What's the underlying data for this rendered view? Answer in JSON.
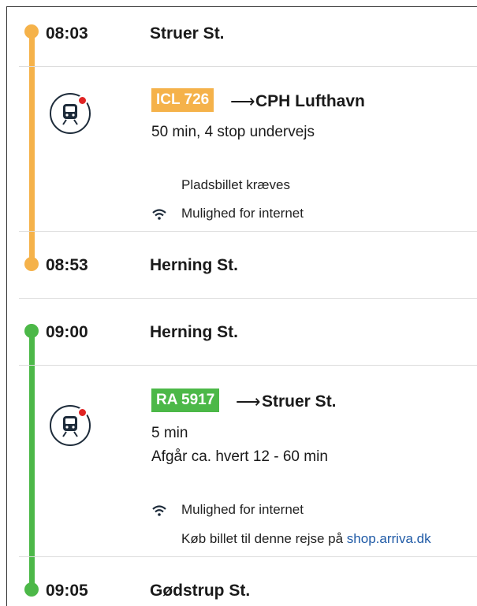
{
  "leg1": {
    "departure_time": "08:03",
    "departure_station": "Struer St.",
    "train_badge": "ICL 726",
    "arrow": "⟶",
    "destination": "CPH Lufthavn",
    "duration": "50 min, 4 stop undervejs",
    "note1": "Pladsbillet kræves",
    "note2": "Mulighed for internet",
    "arrival_time": "08:53",
    "arrival_station": "Herning St."
  },
  "leg2": {
    "departure_time": "09:00",
    "departure_station": "Herning St.",
    "train_badge": "RA 5917",
    "arrow": "⟶",
    "destination": "Struer St.",
    "duration": "5 min",
    "frequency": "Afgår ca. hvert 12 - 60 min",
    "note1": "Mulighed for internet",
    "buy_prefix": "Køb billet til denne rejse på",
    "buy_link": "shop.arriva.dk",
    "arrival_time": "09:05",
    "arrival_station": "Gødstrup St."
  },
  "colors": {
    "leg1": "#f5b24a",
    "leg2": "#4cb848",
    "link": "#1f5aa6"
  },
  "icons": [
    "train-icon",
    "wifi-icon"
  ]
}
